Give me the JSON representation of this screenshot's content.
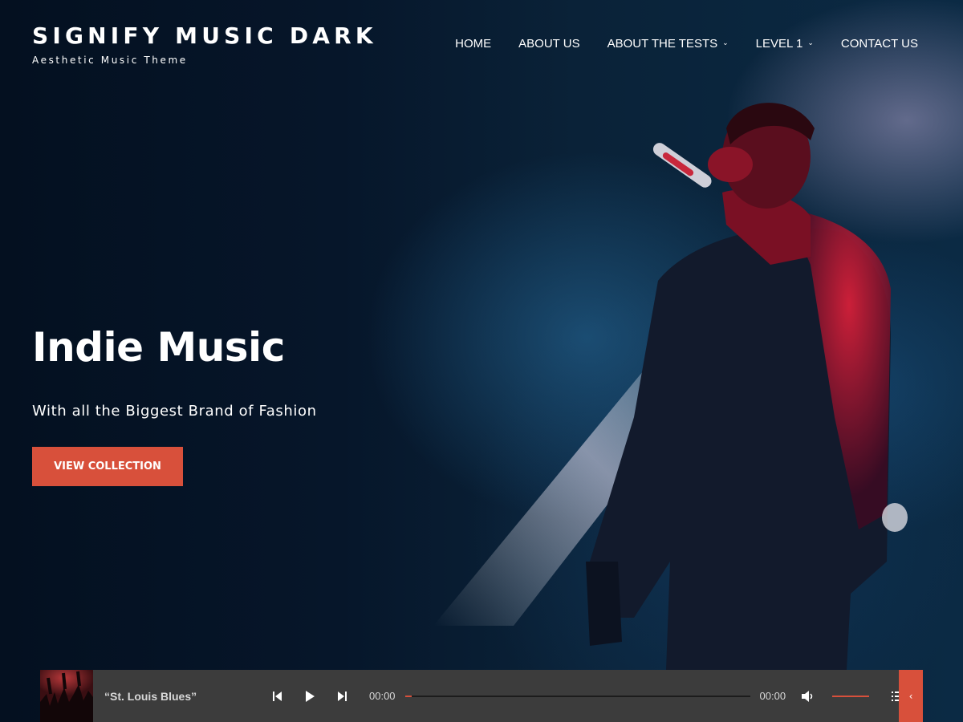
{
  "site": {
    "title": "SIGNIFY MUSIC DARK",
    "tagline": "Aesthetic Music Theme"
  },
  "nav": {
    "items": [
      {
        "label": "HOME",
        "has_dropdown": false
      },
      {
        "label": "ABOUT US",
        "has_dropdown": false
      },
      {
        "label": "ABOUT THE TESTS",
        "has_dropdown": true
      },
      {
        "label": "LEVEL 1",
        "has_dropdown": true
      },
      {
        "label": "CONTACT US",
        "has_dropdown": false
      }
    ],
    "dropdown_icon": "chevron-down-icon"
  },
  "hero": {
    "title": "Indie Music",
    "subtitle": "With all the Biggest Brand of Fashion",
    "button_label": "VIEW COLLECTION",
    "accent_color": "#d8503b"
  },
  "player": {
    "track_title": "“St. Louis Blues”",
    "current_time": "00:00",
    "duration": "00:00",
    "progress": 0.02,
    "volume": 1.0,
    "icons": {
      "prev": "skip-back-icon",
      "play": "play-icon",
      "next": "skip-forward-icon",
      "volume": "volume-icon",
      "playlist": "playlist-icon",
      "toggle": "chevron-left-icon"
    },
    "toggle_glyph": "‹"
  }
}
